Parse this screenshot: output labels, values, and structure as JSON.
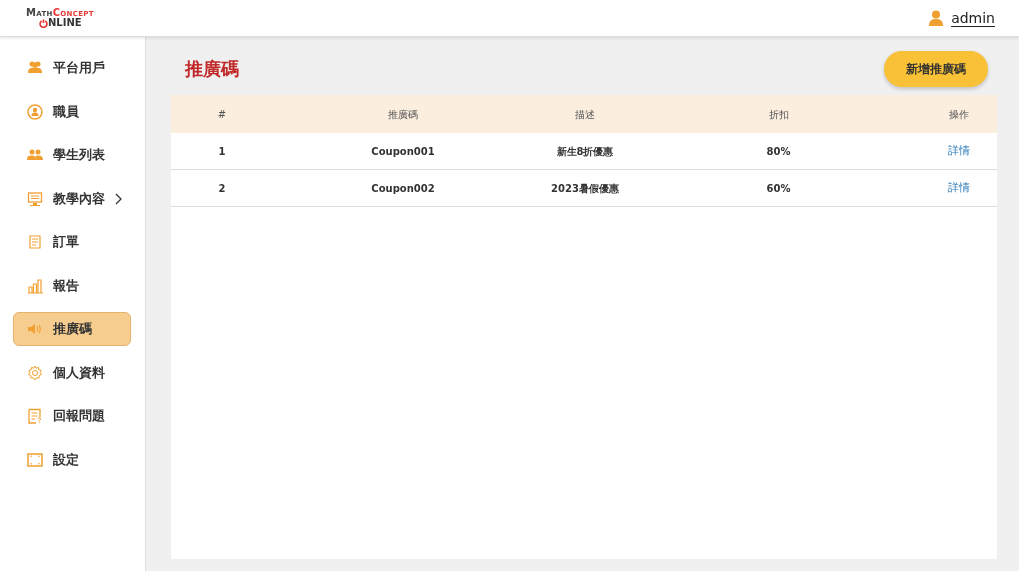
{
  "logo": {
    "line1_a": "Math",
    "line1_b": "Concept",
    "line2": "NLINE"
  },
  "user": {
    "name": "admin"
  },
  "sidebar": {
    "items": [
      {
        "label": "平台用戶",
        "selected": false,
        "has_submenu": false
      },
      {
        "label": "職員",
        "selected": false,
        "has_submenu": false
      },
      {
        "label": "學生列表",
        "selected": false,
        "has_submenu": false
      },
      {
        "label": "教學內容",
        "selected": false,
        "has_submenu": true
      },
      {
        "label": "訂單",
        "selected": false,
        "has_submenu": false
      },
      {
        "label": "報告",
        "selected": false,
        "has_submenu": false
      },
      {
        "label": "推廣碼",
        "selected": true,
        "has_submenu": false
      },
      {
        "label": "個人資料",
        "selected": false,
        "has_submenu": false
      },
      {
        "label": "回報問題",
        "selected": false,
        "has_submenu": false
      },
      {
        "label": "設定",
        "selected": false,
        "has_submenu": false
      }
    ]
  },
  "page_title": "推廣碼",
  "add_button": "新增推廣碼",
  "table": {
    "columns": [
      "#",
      "推廣碼",
      "描述",
      "折扣",
      "操作"
    ],
    "rows": [
      {
        "index": "1",
        "code": "Coupon001",
        "description": "新生8折優惠",
        "discount": "80%",
        "action": "詳情"
      },
      {
        "index": "2",
        "code": "Coupon002",
        "description": "2023暑假優惠",
        "discount": "60%",
        "action": "詳情"
      }
    ]
  }
}
